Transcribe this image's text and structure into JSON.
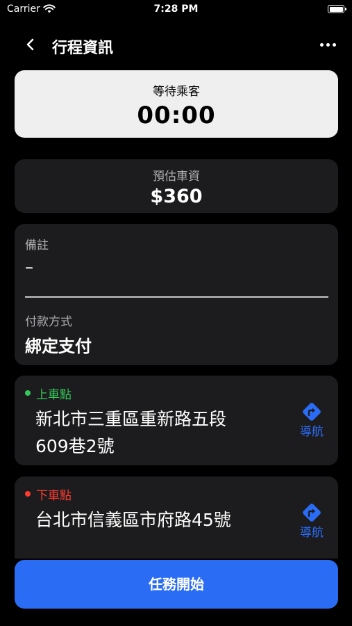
{
  "status_bar": {
    "carrier": "Carrier",
    "time": "7:28 PM"
  },
  "header": {
    "title": "行程資訊"
  },
  "timer": {
    "label": "等待乘客",
    "value": "00:00"
  },
  "fare": {
    "label": "預估車資",
    "value": "$360"
  },
  "info": {
    "note_label": "備註",
    "note_value": "–",
    "payment_label": "付款方式",
    "payment_value": "綁定支付"
  },
  "pickup": {
    "label": "上車點",
    "address_line1": "新北市三重區重新路五段",
    "address_line2": "609巷2號",
    "navigate_label": "導航",
    "color": "#34c759"
  },
  "dropoff": {
    "label": "下車點",
    "address": "台北市信義區市府路45號",
    "navigate_label": "導航",
    "color": "#ff3b30"
  },
  "action": {
    "start_label": "任務開始"
  },
  "colors": {
    "accent": "#2a6df4",
    "timer_card_bg": "#efeff0",
    "card_bg": "#1c1c1e"
  },
  "icons": [
    "wifi-icon",
    "battery-icon",
    "back-chevron-icon",
    "more-icon",
    "directions-icon"
  ]
}
